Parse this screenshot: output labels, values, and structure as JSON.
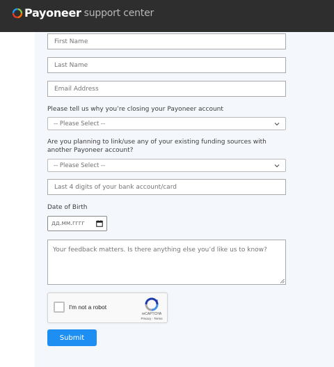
{
  "header": {
    "brand": "Payoneer",
    "subtitle": "support center",
    "background": "#2e2e2e"
  },
  "form": {
    "first_name": {
      "placeholder": "First Name"
    },
    "last_name": {
      "placeholder": "Last Name"
    },
    "email": {
      "placeholder": "Email Address"
    },
    "closing_reason": {
      "label": "Please tell us why you’re closing your Payoneer account",
      "selected": "-- Please Select --"
    },
    "funding_sources": {
      "label": "Are you planning to link/use any of your existing funding sources with another Payoneer account?",
      "selected": "-- Please Select --"
    },
    "bank_digits": {
      "placeholder": "Last 4 digits of your bank account/card"
    },
    "dob": {
      "label": "Date of Birth",
      "placeholder": "дд.мм.гггг"
    },
    "feedback": {
      "placeholder": "Your feedback matters. Is there anything else you’d like us to know?"
    },
    "recaptcha": {
      "label": "I'm not a robot",
      "brand": "reCAPTCHA",
      "terms": "Privacy - Terms"
    },
    "submit_label": "Submit"
  },
  "colors": {
    "accent": "#1e8ff2",
    "panel": "#f4f7fb"
  }
}
